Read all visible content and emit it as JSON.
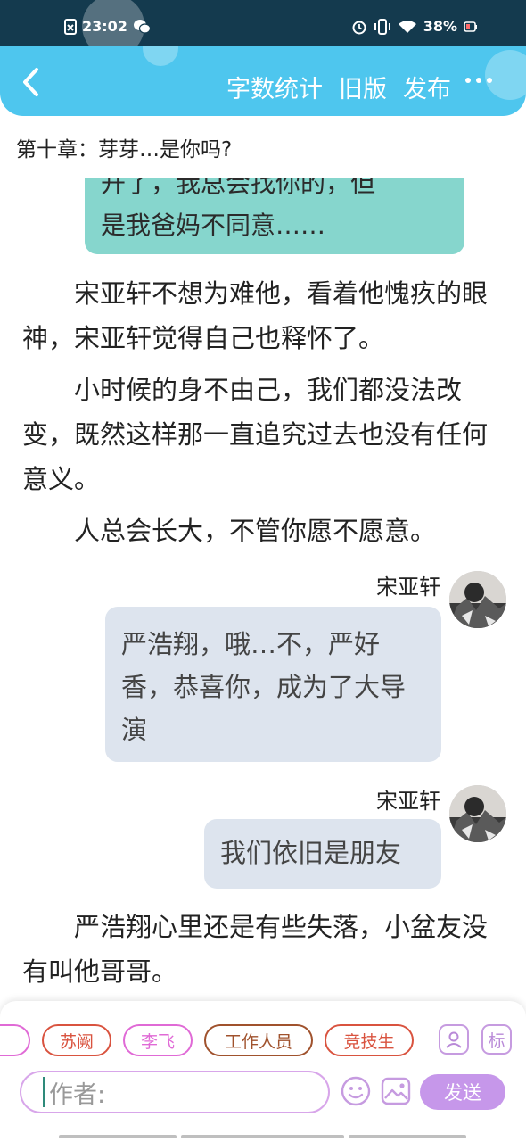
{
  "status_bar": {
    "time": "23:02",
    "battery": "38%",
    "left_icons": [
      "file-x-icon",
      "wechat-icon"
    ],
    "right_icons": [
      "alarm-icon",
      "vibrate-icon",
      "wifi-icon",
      "battery-icon"
    ]
  },
  "header": {
    "back_icon": "chevron-left-icon",
    "actions": [
      "字数统计",
      "旧版",
      "发布"
    ],
    "more_icon": "more-dots-icon",
    "background": "#4ec6ee"
  },
  "chapter_title": "第十章：芽芽…是你吗?",
  "story": {
    "partial_bubble_line1": "开了，我总会找你的，但",
    "partial_bubble_line2": "是我爸妈不同意……",
    "paragraphs": [
      "宋亚轩不想为难他，看着他愧疚的眼神，宋亚轩觉得自己也释怀了。",
      "小时候的身不由己，我们都没法改变，既然这样那一直追究过去也没有任何意义。",
      "人总会长大，不管你愿不愿意。",
      "严浩翔心里还是有些失落，小盆友没有叫他哥哥。"
    ],
    "messages": [
      {
        "speaker": "宋亚轩",
        "text": "严浩翔，哦…不，严好香，恭喜你，成为了大导演"
      },
      {
        "speaker": "宋亚轩",
        "text": "我们依旧是朋友"
      }
    ]
  },
  "bottom": {
    "characters": [
      {
        "name": "苏阙",
        "color": "#d9533f"
      },
      {
        "name": "李飞",
        "color": "#e06ad6"
      },
      {
        "name": "工作人员",
        "color": "#a0522d"
      },
      {
        "name": "竞技生",
        "color": "#d9533f"
      }
    ],
    "author_placeholder": "作者:",
    "send_label": "发送",
    "tag_label": "标",
    "accent": "#c697ea"
  }
}
